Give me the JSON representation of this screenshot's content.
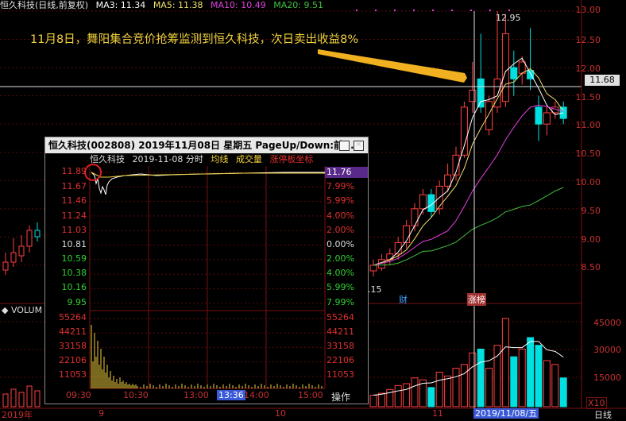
{
  "header": {
    "stock_period": "恒久科技(日线,前复权)",
    "ma3": "MA3: 11.34",
    "ma5": "MA5: 11.38",
    "ma10": "MA10: 10.49",
    "ma20": "MA20: 9.51"
  },
  "price_axis": [
    "13.00",
    "12.50",
    "12.00",
    "11.50",
    "11.00",
    "10.50",
    "10.00",
    "9.50",
    "9.00",
    "8.50"
  ],
  "current_price": "11.68",
  "high_label": "12.95",
  "low_label": ".15",
  "markers": {
    "cai": "财",
    "zhangting": "涨榜"
  },
  "annotation": "11月8日，舞阳集合竞价抢筹监测到恒久科技，次日卖出收益8%",
  "volume": {
    "title": "VOLUM",
    "axis": [
      "45000",
      "30000",
      "15000"
    ],
    "unit": "X10"
  },
  "x_axis": {
    "d2019": "2019年",
    "d9": "9",
    "d10": "10",
    "d11": "11",
    "selected": "2019/11/08/五",
    "period": "日线"
  },
  "intraday": {
    "title": "恒久科技(002808)  2019年11月08日  星期五  PageUp/Down:前...",
    "sub_name": "恒久科技",
    "sub_date": "2019-11-08 分时",
    "sub_avg": "均线",
    "sub_vol": "成交量",
    "sub_limit": "涨停板坐标",
    "price_left": [
      "11.89",
      "11.67",
      "11.46",
      "11.24",
      "11.03",
      "10.81",
      "10.59",
      "10.38",
      "10.16",
      "9.95"
    ],
    "price_right": [
      "11.76",
      "7.99%",
      "5.99%",
      "4.00%",
      "2.00%",
      "0.00%",
      "2.00%",
      "4.00%",
      "5.99%",
      "7.99%"
    ],
    "vol_axis": [
      "55264",
      "44211",
      "33158",
      "22106",
      "11053"
    ],
    "time_axis": [
      "09:30",
      "10:30",
      "13:00",
      "13:36",
      "14:00",
      "15:00"
    ],
    "op_button": "操作"
  },
  "colors": {
    "up": "#ff4040",
    "down": "#00e0e0",
    "ma3": "#ffffff",
    "ma5": "#f0e070",
    "ma10": "#e040e0",
    "ma20": "#40c040",
    "accent": "#f0d23c"
  },
  "chart_data": {
    "type": "candlestick",
    "title": "恒久科技(日线,前复权)",
    "ylim": [
      8.2,
      13.1
    ],
    "candles": [
      {
        "o": 8.4,
        "c": 8.5,
        "h": 8.6,
        "l": 8.3
      },
      {
        "o": 8.45,
        "c": 8.6,
        "h": 8.7,
        "l": 8.4
      },
      {
        "o": 8.6,
        "c": 8.7,
        "h": 8.8,
        "l": 8.5
      },
      {
        "o": 8.7,
        "c": 8.9,
        "h": 9.0,
        "l": 8.6
      },
      {
        "o": 8.9,
        "c": 9.2,
        "h": 9.3,
        "l": 8.8
      },
      {
        "o": 9.2,
        "c": 9.5,
        "h": 9.6,
        "l": 9.1
      },
      {
        "o": 9.5,
        "c": 9.75,
        "h": 9.85,
        "l": 9.4
      },
      {
        "o": 9.75,
        "c": 9.45,
        "h": 9.85,
        "l": 9.35
      },
      {
        "o": 9.5,
        "c": 9.9,
        "h": 10.0,
        "l": 9.4
      },
      {
        "o": 9.9,
        "c": 10.1,
        "h": 10.3,
        "l": 9.8
      },
      {
        "o": 10.1,
        "c": 10.45,
        "h": 10.6,
        "l": 10.0
      },
      {
        "o": 10.45,
        "c": 11.3,
        "h": 11.4,
        "l": 10.4
      },
      {
        "o": 11.4,
        "c": 11.6,
        "h": 12.1,
        "l": 11.2
      },
      {
        "o": 11.8,
        "c": 11.3,
        "h": 12.6,
        "l": 11.2
      },
      {
        "o": 10.9,
        "c": 11.4,
        "h": 11.5,
        "l": 10.8
      },
      {
        "o": 11.3,
        "c": 11.8,
        "h": 13.0,
        "l": 11.2
      },
      {
        "o": 11.4,
        "c": 12.6,
        "h": 12.95,
        "l": 11.3
      },
      {
        "o": 12.0,
        "c": 11.8,
        "h": 12.3,
        "l": 11.5
      },
      {
        "o": 11.9,
        "c": 12.1,
        "h": 12.2,
        "l": 11.7
      },
      {
        "o": 11.95,
        "c": 11.8,
        "h": 12.7,
        "l": 11.6
      },
      {
        "o": 11.3,
        "c": 11.0,
        "h": 11.5,
        "l": 10.7
      },
      {
        "o": 11.0,
        "c": 11.2,
        "h": 11.3,
        "l": 10.8
      },
      {
        "o": 11.2,
        "c": 11.3,
        "h": 11.4,
        "l": 11.1
      },
      {
        "o": 11.3,
        "c": 11.1,
        "h": 11.4,
        "l": 11.0
      }
    ],
    "volumes": [
      6000,
      7000,
      9000,
      11000,
      12000,
      15000,
      14000,
      10000,
      18000,
      16000,
      20000,
      22000,
      28000,
      30000,
      20000,
      32000,
      46000,
      26000,
      30000,
      36000,
      32000,
      24000,
      22000,
      15000
    ],
    "ma_lines": [
      "MA3",
      "MA5",
      "MA10",
      "MA20"
    ]
  }
}
